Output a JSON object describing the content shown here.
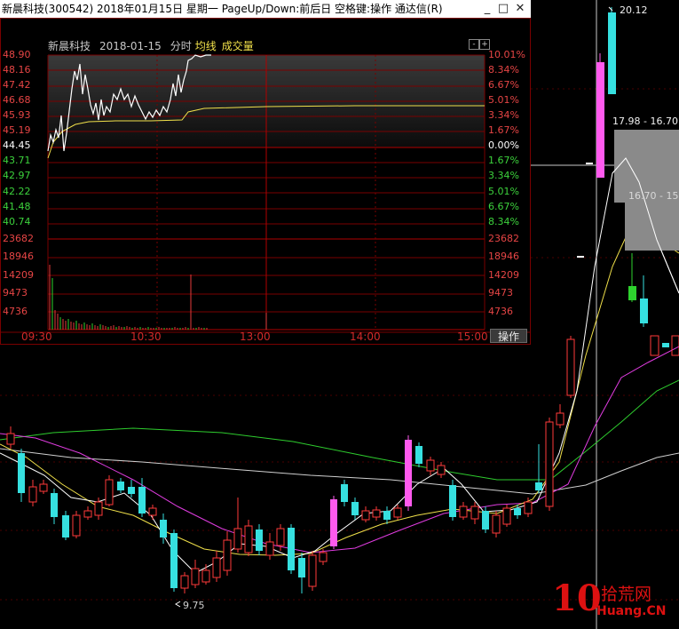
{
  "window": {
    "title": "新晨科技(300542) 2018年01月15日 星期一 PageUp/Down:前后日 空格键:操作 通达信(R)",
    "min_button": "_",
    "max_button": "□",
    "close_button": "✕"
  },
  "header": {
    "stock": "新晨科技",
    "date": "2018-01-15",
    "mode": "分时",
    "legend_avg": "均线",
    "legend_vol": "成交量"
  },
  "price_left": [
    {
      "t": "48.90",
      "c": "#e64545"
    },
    {
      "t": "48.16",
      "c": "#e64545"
    },
    {
      "t": "47.42",
      "c": "#e64545"
    },
    {
      "t": "46.68",
      "c": "#e64545"
    },
    {
      "t": "45.93",
      "c": "#e64545"
    },
    {
      "t": "45.19",
      "c": "#e64545"
    },
    {
      "t": "44.45",
      "c": "#ffffff"
    },
    {
      "t": "43.71",
      "c": "#3cd23c"
    },
    {
      "t": "42.97",
      "c": "#3cd23c"
    },
    {
      "t": "42.22",
      "c": "#3cd23c"
    },
    {
      "t": "41.48",
      "c": "#3cd23c"
    },
    {
      "t": "40.74",
      "c": "#3cd23c"
    }
  ],
  "price_right": [
    {
      "t": "10.01%",
      "c": "#e64545"
    },
    {
      "t": "8.34%",
      "c": "#e64545"
    },
    {
      "t": "6.67%",
      "c": "#e64545"
    },
    {
      "t": "5.01%",
      "c": "#e64545"
    },
    {
      "t": "3.34%",
      "c": "#e64545"
    },
    {
      "t": "1.67%",
      "c": "#e64545"
    },
    {
      "t": "0.00%",
      "c": "#ffffff"
    },
    {
      "t": "1.67%",
      "c": "#3cd23c"
    },
    {
      "t": "3.34%",
      "c": "#3cd23c"
    },
    {
      "t": "5.01%",
      "c": "#3cd23c"
    },
    {
      "t": "6.67%",
      "c": "#3cd23c"
    },
    {
      "t": "8.34%",
      "c": "#3cd23c"
    }
  ],
  "volume_labels": [
    "23682",
    "18946",
    "14209",
    "9473",
    "4736"
  ],
  "time_labels": [
    "09:30",
    "10:30",
    "13:00",
    "14:00",
    "15:00"
  ],
  "op_button": "操作",
  "kline": {
    "high_label": "20.12",
    "range_top": "17.98 - 16.70",
    "range_mid": "16.70 - 15",
    "low_label": "9.75"
  },
  "watermark": {
    "brand_num": "10",
    "brand_cn": "拾荒网",
    "brand_url": "Huang.CN"
  },
  "colors": {
    "up": "#ff3a3a",
    "down": "#36e0e0",
    "limit_up": "#ff5aee",
    "grid": "#7a0000"
  }
}
